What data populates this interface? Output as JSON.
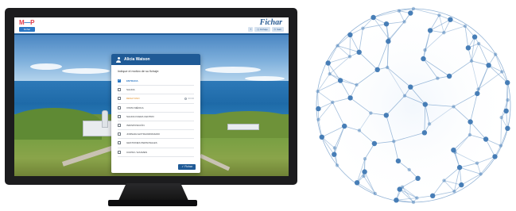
{
  "app": {
    "logo_text_left": "M",
    "logo_text_right": "P",
    "app_chip": "Fichar",
    "brand": "Fichar",
    "top_actions": [
      {
        "icon": "info-icon",
        "label": ""
      },
      {
        "icon": "clock-icon",
        "label": "Fichaje"
      },
      {
        "icon": "power-icon",
        "label": "Salir"
      }
    ]
  },
  "modal": {
    "user_name": "Alicia Watson",
    "prompt": "Indique el motivo de su fichaje:",
    "options": [
      {
        "label": "ENTRADA",
        "checked": true,
        "time": ""
      },
      {
        "label": "SALIDA",
        "checked": false,
        "time": ""
      },
      {
        "label": "DESAYUNO",
        "checked": false,
        "time": "00:00"
      },
      {
        "label": "VISITA MÉDICA",
        "checked": false,
        "time": ""
      },
      {
        "label": "SALIDA FUERA CENTRO",
        "checked": false,
        "time": ""
      },
      {
        "label": "INDISPOSICIÓN",
        "checked": false,
        "time": ""
      },
      {
        "label": "JORNADA EXTRAORDINARIO",
        "checked": false,
        "time": ""
      },
      {
        "label": "GESTIONES PERSONALES",
        "checked": false,
        "time": ""
      },
      {
        "label": "CURSO / EXAMEN",
        "checked": false,
        "time": ""
      }
    ],
    "submit_label": "Fichar"
  },
  "colors": {
    "primary": "#1f5a96",
    "accent": "#2a77c4",
    "highlight": "#e08a1e",
    "logo_red": "#e23d4b",
    "globe_line": "#7fa6cf",
    "globe_node": "#3f78b3"
  }
}
